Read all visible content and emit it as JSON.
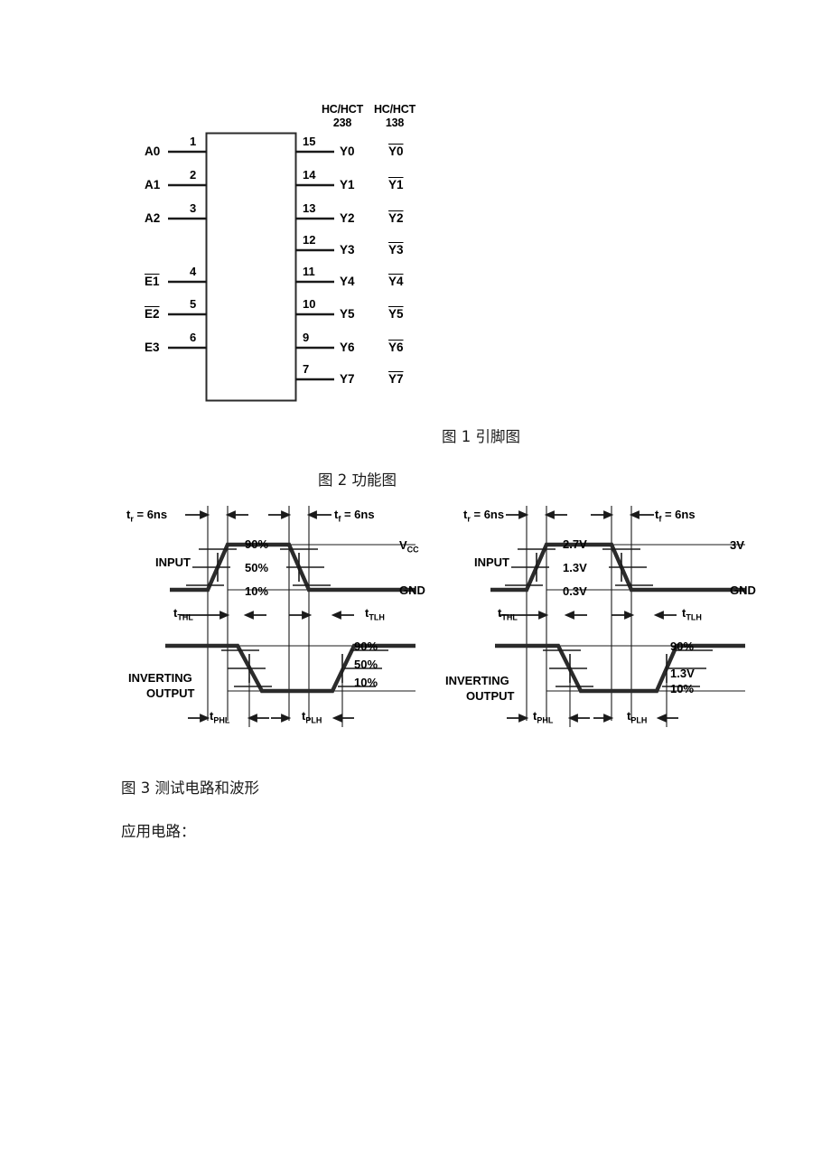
{
  "document": {
    "page_background": "#ffffff",
    "ink_color": "#1a1a1a"
  },
  "figure1": {
    "caption": "图 1  引脚图",
    "column_headers": [
      {
        "line1": "HC/HCT",
        "line2": "238"
      },
      {
        "line1": "HC/HCT",
        "line2": "138"
      }
    ],
    "inputs": [
      {
        "name": "A0",
        "pin": "1",
        "overline": false
      },
      {
        "name": "A1",
        "pin": "2",
        "overline": false
      },
      {
        "name": "A2",
        "pin": "3",
        "overline": false
      },
      {
        "name": "E1",
        "pin": "4",
        "overline": true
      },
      {
        "name": "E2",
        "pin": "5",
        "overline": true
      },
      {
        "name": "E3",
        "pin": "6",
        "overline": false
      }
    ],
    "outputs": [
      {
        "pin": "15",
        "label_238": "Y0",
        "label_138": "Y0"
      },
      {
        "pin": "14",
        "label_238": "Y1",
        "label_138": "Y1"
      },
      {
        "pin": "13",
        "label_238": "Y2",
        "label_138": "Y2"
      },
      {
        "pin": "12",
        "label_238": "Y3",
        "label_138": "Y3"
      },
      {
        "pin": "11",
        "label_238": "Y4",
        "label_138": "Y4"
      },
      {
        "pin": "10",
        "label_238": "Y5",
        "label_138": "Y5"
      },
      {
        "pin": "9",
        "label_238": "Y6",
        "label_138": "Y6"
      },
      {
        "pin": "7",
        "label_238": "Y7",
        "label_138": "Y7"
      }
    ]
  },
  "figure2": {
    "caption": "图 2  功能图"
  },
  "figure3": {
    "caption": "图 3  测试电路和波形",
    "note": "应用电路：",
    "panels": [
      {
        "id": "hc-cmos-levels",
        "rise_time": "t",
        "rise_time_sub": "r",
        "rise_time_value": "= 6ns",
        "fall_time": "t",
        "fall_time_sub": "f",
        "fall_time_value": "= 6ns",
        "input_label": "INPUT",
        "output_label_line1": "INVERTING",
        "output_label_line2": "OUTPUT",
        "high_rail": "V",
        "high_rail_sub": "CC",
        "low_rail": "GND",
        "input_thresholds": [
          "90%",
          "50%",
          "10%"
        ],
        "output_thresholds": [
          "90%",
          "50%",
          "10%"
        ],
        "delay_labels": [
          {
            "base": "t",
            "sub": "THL"
          },
          {
            "base": "t",
            "sub": "TLH"
          },
          {
            "base": "t",
            "sub": "PHL"
          },
          {
            "base": "t",
            "sub": "PLH"
          }
        ]
      },
      {
        "id": "hct-ttl-levels",
        "rise_time": "t",
        "rise_time_sub": "r",
        "rise_time_value": "= 6ns",
        "fall_time": "t",
        "fall_time_sub": "f",
        "fall_time_value": "= 6ns",
        "input_label": "INPUT",
        "output_label_line1": "INVERTING",
        "output_label_line2": "OUTPUT",
        "high_rail": "3V",
        "high_rail_sub": "",
        "low_rail": "GND",
        "input_thresholds": [
          "2.7V",
          "1.3V",
          "0.3V"
        ],
        "output_thresholds": [
          "90%",
          "1.3V",
          "10%"
        ],
        "delay_labels": [
          {
            "base": "t",
            "sub": "THL"
          },
          {
            "base": "t",
            "sub": "TLH"
          },
          {
            "base": "t",
            "sub": "PHL"
          },
          {
            "base": "t",
            "sub": "PLH"
          }
        ]
      }
    ]
  }
}
